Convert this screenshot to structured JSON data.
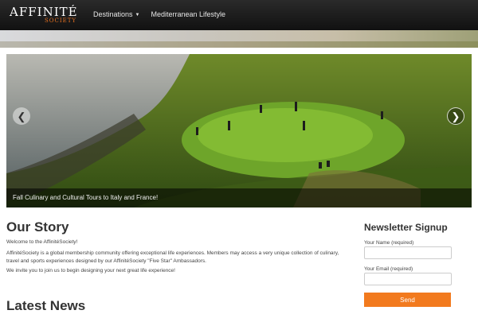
{
  "header": {
    "logo": {
      "main": "AFFINITÉ",
      "sub": "SOCIETY"
    },
    "nav": [
      {
        "label": "Destinations",
        "has_dropdown": true
      },
      {
        "label": "Mediterranean Lifestyle",
        "has_dropdown": false
      }
    ]
  },
  "slider": {
    "caption": "Fall Culinary and Cultural Tours to Italy and France!",
    "prev_icon": "chevron-left-icon",
    "next_icon": "chevron-right-icon"
  },
  "main": {
    "story_title": "Our Story",
    "paragraphs": [
      "Welcome to the AffinitéSociety!",
      "AffinitéSociety is a global membership community offering exceptional life experiences. Members may access a very unique collection of culinary, travel and sports experiences designed by our AffinitéSociety \"Five Star\" Ambassadors.",
      "We invite you to join us to begin designing your next great life experience!"
    ],
    "news_title": "Latest News"
  },
  "sidebar": {
    "title": "Newsletter Signup",
    "name_label": "Your Name (required)",
    "email_label": "Your Email (required)",
    "name_value": "",
    "email_value": "",
    "send_label": "Send"
  },
  "colors": {
    "accent": "#f27a1e",
    "header_bg": "#111111",
    "logo_sub": "#e8701f"
  }
}
